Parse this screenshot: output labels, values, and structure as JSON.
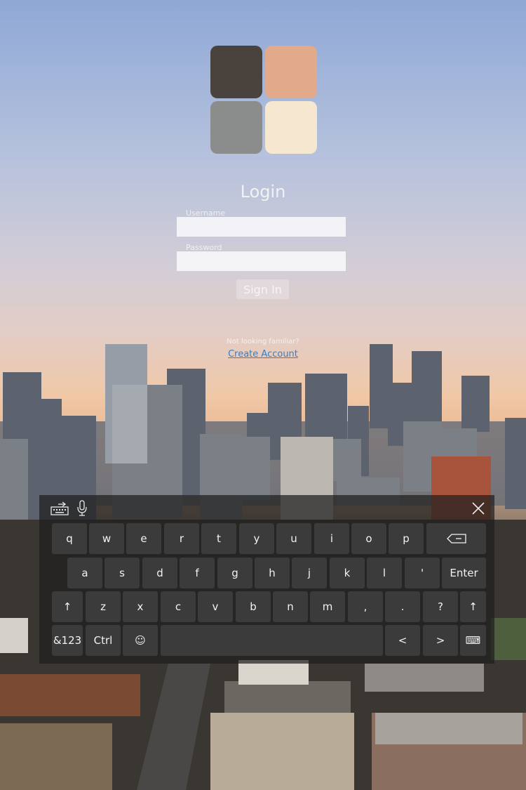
{
  "login": {
    "title": "Login",
    "username_label": "Username",
    "username_value": "",
    "password_label": "Password",
    "password_value": "",
    "sign_in_label": "Sign In",
    "not_familiar_text": "Not looking familiar?",
    "create_account_label": "Create Account"
  },
  "logo": {
    "tile_colors": [
      "#4a433d",
      "#e2a98b",
      "#8b8c8c",
      "#f6e8d0"
    ]
  },
  "keyboard": {
    "toolbar_icons": [
      "keyboard-settings-icon",
      "microphone-icon"
    ],
    "close_icon": "close-icon",
    "row1": [
      "q",
      "w",
      "e",
      "r",
      "t",
      "y",
      "u",
      "i",
      "o",
      "p"
    ],
    "row2": [
      "a",
      "s",
      "d",
      "f",
      "g",
      "h",
      "j",
      "k",
      "l",
      "'",
      "Enter"
    ],
    "row3": [
      "↑",
      "z",
      "x",
      "c",
      "v",
      "b",
      "n",
      "m",
      ",",
      ".",
      "?",
      "↑"
    ],
    "row4": [
      "&123",
      "Ctrl",
      "☺",
      "",
      "<",
      ">",
      "⌨"
    ],
    "backspace_icon": "backspace-icon"
  },
  "colors": {
    "link": "#2f7fd0",
    "key": "#3b3b3b"
  }
}
